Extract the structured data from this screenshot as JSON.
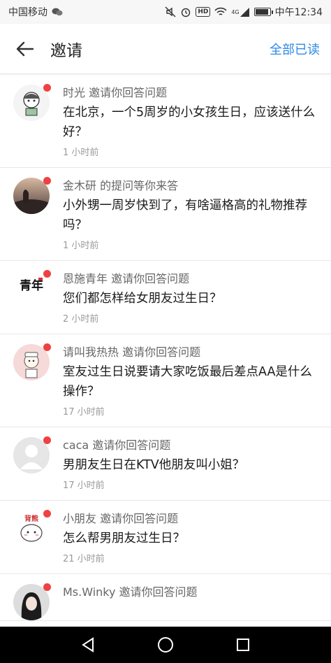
{
  "status_bar": {
    "carrier": "中国移动",
    "time": "中午12:34",
    "hd_badge": "HD",
    "signal_badge": "4G",
    "battery_level": 0.85
  },
  "app_bar": {
    "title": "邀请",
    "mark_all_read": "全部已读"
  },
  "colors": {
    "accent": "#2e8ae6",
    "unread_dot": "#f04142"
  },
  "invitations": [
    {
      "user": "时光",
      "action": "邀请你回答问题",
      "question": "在北京，一个5周岁的小女孩生日，应该送什么好？",
      "time": "1 小时前",
      "avatar_icon": "cartoon-girl-avatar"
    },
    {
      "user": "金木研",
      "action": "的提问等你来答",
      "question": "小外甥一周岁快到了，有啥逼格高的礼物推荐吗？",
      "time": "1 小时前",
      "avatar_icon": "sunset-photo-avatar"
    },
    {
      "user": "恩施青年",
      "action": "邀请你回答问题",
      "question": "您们都怎样给女朋友过生日？",
      "time": "2 小时前",
      "avatar_icon": "calligraphy-avatar",
      "avatar_text": "青年"
    },
    {
      "user": "请叫我热热",
      "action": "邀请你回答问题",
      "question": "室友过生日说要请大家吃饭最后差点AA是什么操作？",
      "time": "17 小时前",
      "avatar_icon": "nurse-cartoon-avatar"
    },
    {
      "user": "caca",
      "action": "邀请你回答问题",
      "question": "男朋友生日在KTV他朋友叫小姐？",
      "time": "17 小时前",
      "avatar_icon": "default-user-avatar"
    },
    {
      "user": "小朋友",
      "action": "邀请你回答问题",
      "question": "怎么帮男朋友过生日？",
      "time": "21 小时前",
      "avatar_icon": "cute-blob-avatar",
      "avatar_text": "背熊"
    },
    {
      "user": "Ms.Winky",
      "action": "邀请你回答问题",
      "question": "",
      "time": "",
      "avatar_icon": "girl-photo-avatar"
    }
  ]
}
